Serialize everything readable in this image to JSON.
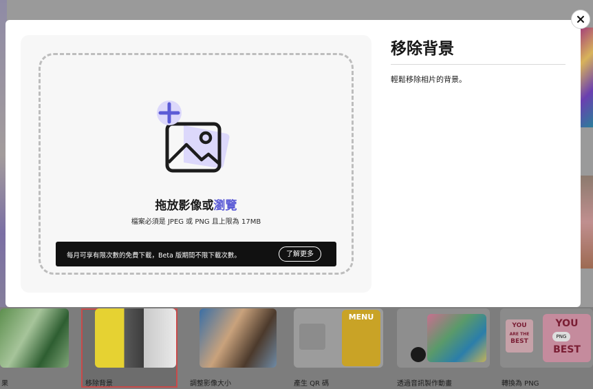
{
  "modal": {
    "title": "移除背景",
    "description": "輕鬆移除相片的背景。",
    "close_label": "×",
    "drop_title_prefix": "拖放影像或",
    "drop_title_link": "瀏覽",
    "drop_subtitle": "檔案必須是 JPEG 或 PNG 且上限為 17MB",
    "notice_text": "每月可享有限次數的免費下載，Beta 版期間不限下載次數。",
    "learn_more_label": "了解更多"
  },
  "colors": {
    "accent": "#5b5bd6",
    "accent_light": "#dcd8fb",
    "notice_bg": "#111111",
    "selected_frame": "#c94a4a"
  },
  "background_tools": [
    {
      "label": "果"
    },
    {
      "label": "移除背景"
    },
    {
      "label": "調整影像大小"
    },
    {
      "label": "產生 QR 碼"
    },
    {
      "label": "透過音訊製作動畫"
    },
    {
      "label": "轉換為 PNG"
    }
  ],
  "thumb_texts": {
    "menu": "MENU",
    "you": "YOU",
    "are_the": "ARE THE",
    "best": "BEST",
    "png_badge": "PNG"
  }
}
